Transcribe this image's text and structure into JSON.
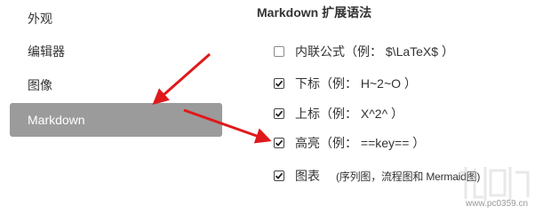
{
  "sidebar": {
    "items": [
      {
        "label": "外观",
        "active": false
      },
      {
        "label": "编辑器",
        "active": false
      },
      {
        "label": "图像",
        "active": false
      },
      {
        "label": "Markdown",
        "active": true
      }
    ]
  },
  "main": {
    "section_title": "Markdown 扩展语法",
    "options": [
      {
        "label": "内联公式（例： $\\LaTeX$ ）",
        "checked": false
      },
      {
        "label": "下标（例： H~2~O ）",
        "checked": true
      },
      {
        "label": "上标（例： X^2^ ）",
        "checked": true
      },
      {
        "label": "高亮（例： ==key== ）",
        "checked": true
      },
      {
        "label": "图表",
        "note": "(序列图，流程图和 Mermaid图)",
        "checked": true
      }
    ]
  },
  "watermark": {
    "text": "www.pc0359.cn"
  },
  "colors": {
    "active_bg": "#9b9b9b",
    "arrow": "#e0191b",
    "text": "#333333"
  }
}
